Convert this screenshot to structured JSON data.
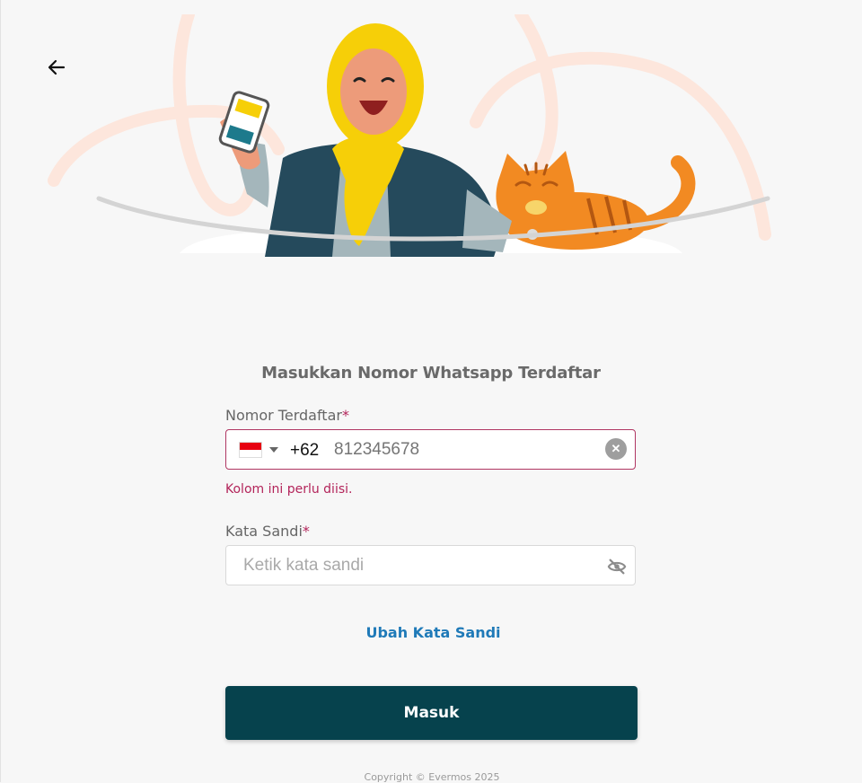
{
  "header": {
    "back_icon": "arrow-left-icon"
  },
  "hero": {
    "illustration": "woman-with-phone-and-cat-illustration"
  },
  "form": {
    "title": "Masukkan Nomor Whatsapp Terdaftar",
    "phone": {
      "label": "Nomor Terdaftar",
      "required_mark": "*",
      "country_flag": "indonesia-flag-icon",
      "dial_code": "+62",
      "placeholder": "812345678",
      "value": "",
      "error": "Kolom ini perlu diisi."
    },
    "password": {
      "label": "Kata Sandi",
      "required_mark": "*",
      "placeholder": "Ketik kata sandi",
      "value": "",
      "toggle_icon": "eye-off-icon"
    },
    "change_password_link": "Ubah Kata Sandi",
    "submit_label": "Masuk"
  },
  "footer": {
    "copyright": "Copyright © Evermos 2025"
  },
  "colors": {
    "primary": "#06424d",
    "error": "#b3245a",
    "link": "#1f7ab8",
    "background": "#f7f7f7"
  }
}
